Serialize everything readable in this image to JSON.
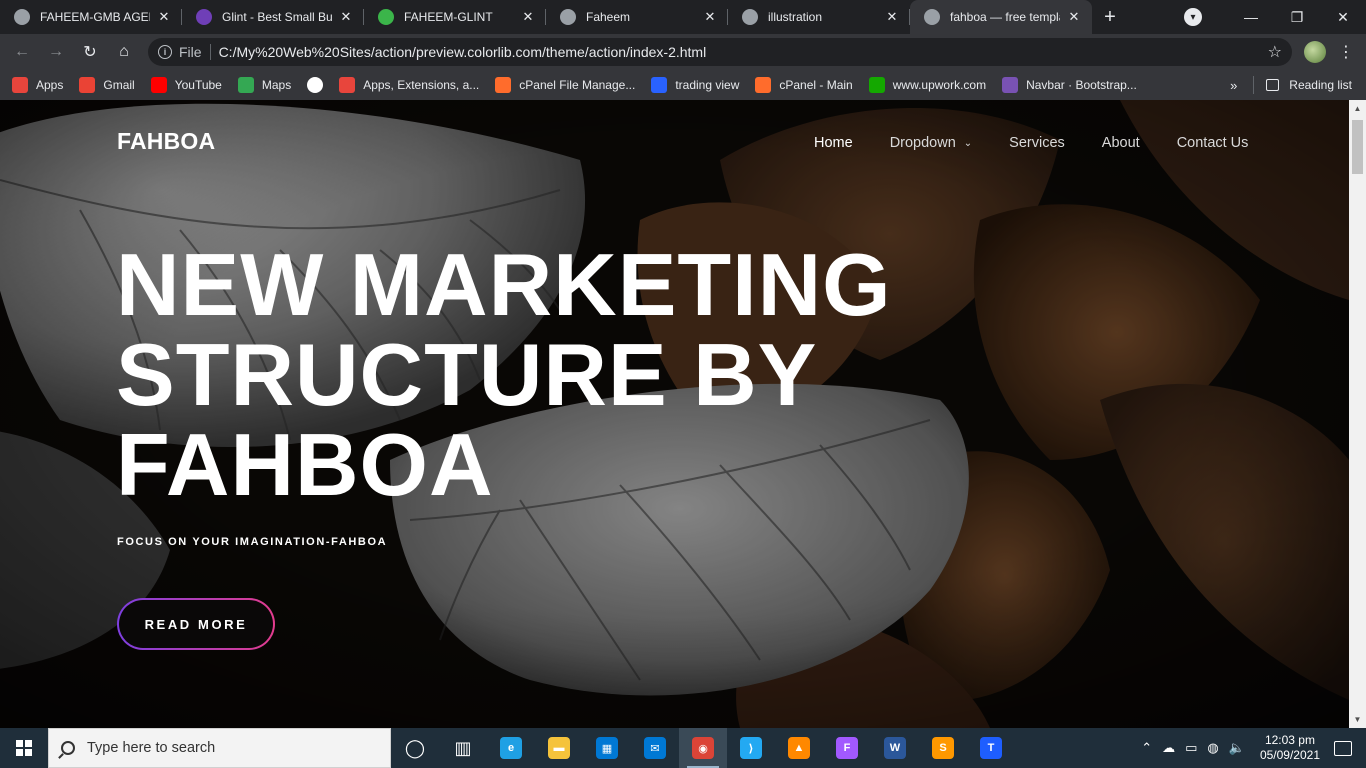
{
  "browser": {
    "tabs": [
      {
        "title": "FAHEEM-GMB AGENCY",
        "icon": "globe-icon",
        "color": "#9aa0a6"
      },
      {
        "title": "Glint - Best Small Busin",
        "icon": "colorlib-icon",
        "color": "#6f3fb7"
      },
      {
        "title": "FAHEEM-GLINT",
        "icon": "glint-g-icon",
        "color": "#3bb54a"
      },
      {
        "title": "Faheem",
        "icon": "globe-icon",
        "color": "#9aa0a6"
      },
      {
        "title": "illustration",
        "icon": "globe-icon",
        "color": "#9aa0a6"
      },
      {
        "title": "fahboa — free templat",
        "icon": "globe-icon",
        "color": "#9aa0a6",
        "active": true
      }
    ],
    "address": {
      "scheme": "File",
      "url": "C:/My%20Web%20Sites/action/preview.colorlib.com/theme/action/index-2.html"
    },
    "bookmarks": [
      {
        "label": "Apps",
        "icon": "apps-grid-icon",
        "color": "#e8453c"
      },
      {
        "label": "Gmail",
        "icon": "gmail-icon",
        "color": "#ea4335"
      },
      {
        "label": "YouTube",
        "icon": "youtube-icon",
        "color": "#ff0000"
      },
      {
        "label": "Maps",
        "icon": "maps-icon",
        "color": "#34a853"
      },
      {
        "label": "",
        "icon": "globe-icon",
        "color": "#ffffff"
      },
      {
        "label": "Apps, Extensions, a...",
        "icon": "extensions-icon",
        "color": "#e8453c"
      },
      {
        "label": "cPanel File Manage...",
        "icon": "cpanel-icon",
        "color": "#ff6c2c"
      },
      {
        "label": "trading view",
        "icon": "tradingview-icon",
        "color": "#2962ff"
      },
      {
        "label": "cPanel - Main",
        "icon": "cpanel-icon",
        "color": "#ff6c2c"
      },
      {
        "label": "www.upwork.com",
        "icon": "upwork-icon",
        "color": "#14a800"
      },
      {
        "label": "Navbar · Bootstrap...",
        "icon": "bootstrap-icon",
        "color": "#7952b3"
      }
    ],
    "more_bookmarks": "»",
    "reading_list": "Reading list"
  },
  "page": {
    "brand": "FAHBOA",
    "menu": [
      {
        "label": "Home",
        "active": true
      },
      {
        "label": "Dropdown",
        "dropdown": true
      },
      {
        "label": "Services"
      },
      {
        "label": "About"
      },
      {
        "label": "Contact Us"
      }
    ],
    "headline": [
      "NEW MARKETING",
      "STRUCTURE BY",
      "FAHBOA"
    ],
    "tagline": "FOCUS ON YOUR IMAGINATION-FAHBOA",
    "cta": "READ MORE",
    "cta_gradient": [
      "#7d3fe0",
      "#e33c8e"
    ]
  },
  "taskbar": {
    "search_placeholder": "Type here to search",
    "apps": [
      {
        "name": "cortana",
        "icon": "cortana-circle-icon",
        "color": "#ffffff"
      },
      {
        "name": "task-view",
        "icon": "task-view-icon",
        "color": "#ffffff"
      },
      {
        "name": "edge",
        "icon": "edge-icon",
        "color": "#1fa0e4"
      },
      {
        "name": "file-explorer",
        "icon": "folder-icon",
        "color": "#f5c33b"
      },
      {
        "name": "store",
        "icon": "store-icon",
        "color": "#0078d4"
      },
      {
        "name": "mail",
        "icon": "mail-icon",
        "color": "#0078d4"
      },
      {
        "name": "chrome",
        "icon": "chrome-icon",
        "color": "#db4437",
        "active": true
      },
      {
        "name": "vscode",
        "icon": "vscode-icon",
        "color": "#23a9f2"
      },
      {
        "name": "vlc",
        "icon": "vlc-icon",
        "color": "#ff8800"
      },
      {
        "name": "figma",
        "icon": "figma-icon",
        "color": "#a259ff"
      },
      {
        "name": "word",
        "icon": "word-icon",
        "color": "#2b579a"
      },
      {
        "name": "sublime",
        "icon": "sublime-icon",
        "color": "#ff9800"
      },
      {
        "name": "typora",
        "icon": "typora-icon",
        "color": "#1e5eff"
      }
    ],
    "time": "12:03 pm",
    "date": "05/09/2021"
  }
}
